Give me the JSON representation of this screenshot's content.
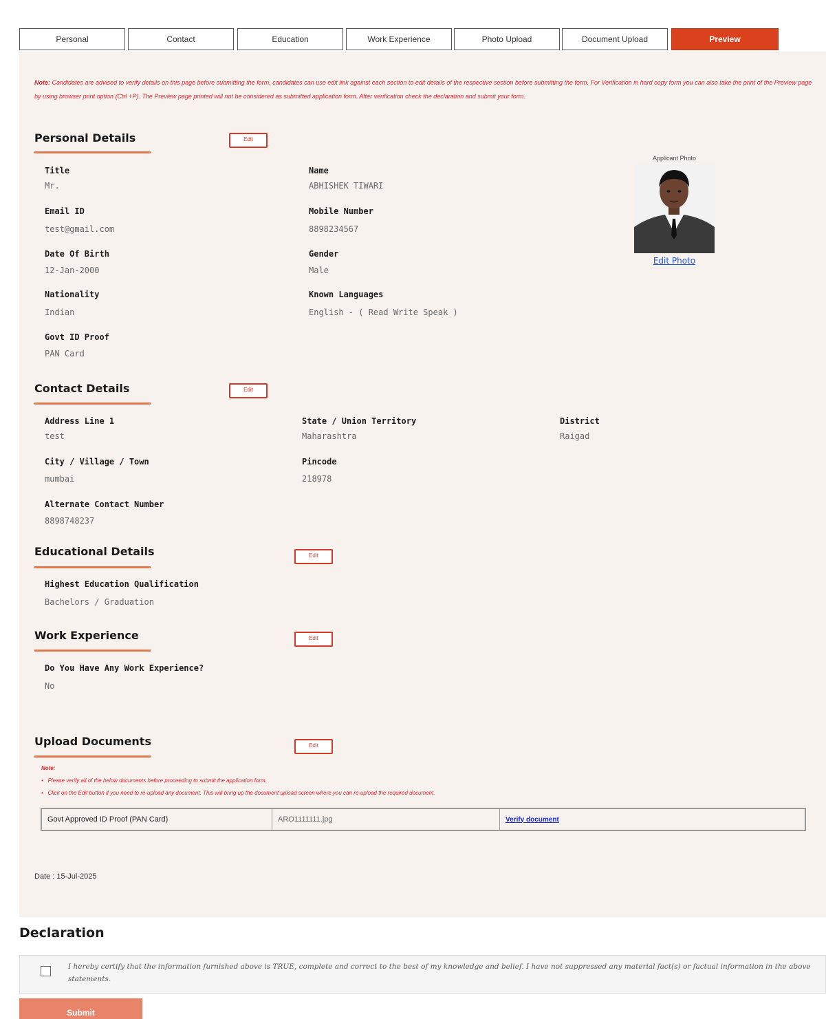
{
  "tabs": [
    {
      "label": "Personal"
    },
    {
      "label": "Contact"
    },
    {
      "label": "Education"
    },
    {
      "label": "Work Experience"
    },
    {
      "label": "Photo Upload"
    },
    {
      "label": "Document Upload"
    },
    {
      "label": "Preview",
      "active": true
    }
  ],
  "note": {
    "prefix": "Note:",
    "text": "Candidates are advised to verify details on this page before submitting the form, candidates can use edit link against each section to edit details of the respective section before submitting the form. For Verification in hard copy form you can also take the print of the Preview page by using browser print option (Ctrl +P). The Preview page printed will not be considered as submitted application form. After verification check the declaration and submit your form."
  },
  "edit_label": "Edit",
  "personal": {
    "title": "Personal Details",
    "fields": {
      "title_label": "Title",
      "title_value": "Mr.",
      "name_label": "Name",
      "name_value": "ABHISHEK TIWARI",
      "email_label": "Email ID",
      "email_value": "test@gmail.com",
      "mobile_label": "Mobile Number",
      "mobile_value": "8898234567",
      "dob_label": "Date Of Birth",
      "dob_value": "12-Jan-2000",
      "gender_label": "Gender",
      "gender_value": "Male",
      "nationality_label": "Nationality",
      "nationality_value": "Indian",
      "languages_label": "Known Languages",
      "languages_value": "English - ( Read Write Speak )",
      "govt_id_label": "Govt ID Proof",
      "govt_id_value": "PAN Card"
    },
    "photo_caption": "Applicant Photo",
    "edit_photo": "Edit Photo"
  },
  "contact": {
    "title": "Contact Details",
    "fields": {
      "address_label": "Address Line 1",
      "address_value": "test",
      "state_label": "State / Union Territory",
      "state_value": "Maharashtra",
      "district_label": "District",
      "district_value": "Raigad",
      "city_label": "City / Village / Town",
      "city_value": "mumbai",
      "pincode_label": "Pincode",
      "pincode_value": "218978",
      "alt_contact_label": "Alternate Contact Number",
      "alt_contact_value": "8898748237"
    }
  },
  "education": {
    "title": "Educational Details",
    "qualification_label": "Highest Education Qualification",
    "qualification_value": "Bachelors / Graduation"
  },
  "work": {
    "title": "Work Experience",
    "question_label": "Do You Have Any Work Experience?",
    "answer_value": "No"
  },
  "documents": {
    "title": "Upload Documents",
    "note_title": "Note:",
    "notes": [
      "Please verify all of the below documents before proceeding to submit the application form.",
      "Click on the Edit button if you need to re-upload any document. This will bring up the document upload screen where you can re-upload the required document."
    ],
    "row": {
      "doc_name": "Govt Approved ID Proof (PAN Card)",
      "file_name": "ARO1111111.jpg",
      "verify_link": "Verify document"
    }
  },
  "date_text": "Date : 15-Jul-2025",
  "declaration": {
    "title": "Declaration",
    "text": "I hereby certify that the information furnished above is TRUE, complete and correct to the best of my knowledge and belief. I have not suppressed any material fact(s) or factual information in the above statements.",
    "checked": false
  },
  "submit_label": "Submit",
  "colors": {
    "accent": "#d9421c",
    "panel_bg": "#f8f2ee",
    "note_red": "#e8202a",
    "link_blue": "#1a56d8",
    "submit_bg": "#e8846a"
  }
}
